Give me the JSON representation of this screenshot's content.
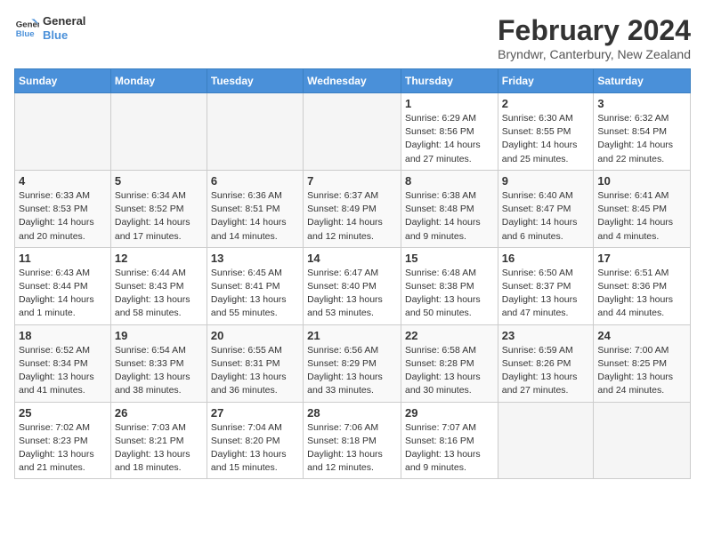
{
  "logo": {
    "line1": "General",
    "line2": "Blue"
  },
  "title": "February 2024",
  "subtitle": "Bryndwr, Canterbury, New Zealand",
  "weekdays": [
    "Sunday",
    "Monday",
    "Tuesday",
    "Wednesday",
    "Thursday",
    "Friday",
    "Saturday"
  ],
  "weeks": [
    [
      {
        "day": "",
        "info": ""
      },
      {
        "day": "",
        "info": ""
      },
      {
        "day": "",
        "info": ""
      },
      {
        "day": "",
        "info": ""
      },
      {
        "day": "1",
        "info": "Sunrise: 6:29 AM\nSunset: 8:56 PM\nDaylight: 14 hours and 27 minutes."
      },
      {
        "day": "2",
        "info": "Sunrise: 6:30 AM\nSunset: 8:55 PM\nDaylight: 14 hours and 25 minutes."
      },
      {
        "day": "3",
        "info": "Sunrise: 6:32 AM\nSunset: 8:54 PM\nDaylight: 14 hours and 22 minutes."
      }
    ],
    [
      {
        "day": "4",
        "info": "Sunrise: 6:33 AM\nSunset: 8:53 PM\nDaylight: 14 hours and 20 minutes."
      },
      {
        "day": "5",
        "info": "Sunrise: 6:34 AM\nSunset: 8:52 PM\nDaylight: 14 hours and 17 minutes."
      },
      {
        "day": "6",
        "info": "Sunrise: 6:36 AM\nSunset: 8:51 PM\nDaylight: 14 hours and 14 minutes."
      },
      {
        "day": "7",
        "info": "Sunrise: 6:37 AM\nSunset: 8:49 PM\nDaylight: 14 hours and 12 minutes."
      },
      {
        "day": "8",
        "info": "Sunrise: 6:38 AM\nSunset: 8:48 PM\nDaylight: 14 hours and 9 minutes."
      },
      {
        "day": "9",
        "info": "Sunrise: 6:40 AM\nSunset: 8:47 PM\nDaylight: 14 hours and 6 minutes."
      },
      {
        "day": "10",
        "info": "Sunrise: 6:41 AM\nSunset: 8:45 PM\nDaylight: 14 hours and 4 minutes."
      }
    ],
    [
      {
        "day": "11",
        "info": "Sunrise: 6:43 AM\nSunset: 8:44 PM\nDaylight: 14 hours and 1 minute."
      },
      {
        "day": "12",
        "info": "Sunrise: 6:44 AM\nSunset: 8:43 PM\nDaylight: 13 hours and 58 minutes."
      },
      {
        "day": "13",
        "info": "Sunrise: 6:45 AM\nSunset: 8:41 PM\nDaylight: 13 hours and 55 minutes."
      },
      {
        "day": "14",
        "info": "Sunrise: 6:47 AM\nSunset: 8:40 PM\nDaylight: 13 hours and 53 minutes."
      },
      {
        "day": "15",
        "info": "Sunrise: 6:48 AM\nSunset: 8:38 PM\nDaylight: 13 hours and 50 minutes."
      },
      {
        "day": "16",
        "info": "Sunrise: 6:50 AM\nSunset: 8:37 PM\nDaylight: 13 hours and 47 minutes."
      },
      {
        "day": "17",
        "info": "Sunrise: 6:51 AM\nSunset: 8:36 PM\nDaylight: 13 hours and 44 minutes."
      }
    ],
    [
      {
        "day": "18",
        "info": "Sunrise: 6:52 AM\nSunset: 8:34 PM\nDaylight: 13 hours and 41 minutes."
      },
      {
        "day": "19",
        "info": "Sunrise: 6:54 AM\nSunset: 8:33 PM\nDaylight: 13 hours and 38 minutes."
      },
      {
        "day": "20",
        "info": "Sunrise: 6:55 AM\nSunset: 8:31 PM\nDaylight: 13 hours and 36 minutes."
      },
      {
        "day": "21",
        "info": "Sunrise: 6:56 AM\nSunset: 8:29 PM\nDaylight: 13 hours and 33 minutes."
      },
      {
        "day": "22",
        "info": "Sunrise: 6:58 AM\nSunset: 8:28 PM\nDaylight: 13 hours and 30 minutes."
      },
      {
        "day": "23",
        "info": "Sunrise: 6:59 AM\nSunset: 8:26 PM\nDaylight: 13 hours and 27 minutes."
      },
      {
        "day": "24",
        "info": "Sunrise: 7:00 AM\nSunset: 8:25 PM\nDaylight: 13 hours and 24 minutes."
      }
    ],
    [
      {
        "day": "25",
        "info": "Sunrise: 7:02 AM\nSunset: 8:23 PM\nDaylight: 13 hours and 21 minutes."
      },
      {
        "day": "26",
        "info": "Sunrise: 7:03 AM\nSunset: 8:21 PM\nDaylight: 13 hours and 18 minutes."
      },
      {
        "day": "27",
        "info": "Sunrise: 7:04 AM\nSunset: 8:20 PM\nDaylight: 13 hours and 15 minutes."
      },
      {
        "day": "28",
        "info": "Sunrise: 7:06 AM\nSunset: 8:18 PM\nDaylight: 13 hours and 12 minutes."
      },
      {
        "day": "29",
        "info": "Sunrise: 7:07 AM\nSunset: 8:16 PM\nDaylight: 13 hours and 9 minutes."
      },
      {
        "day": "",
        "info": ""
      },
      {
        "day": "",
        "info": ""
      }
    ]
  ]
}
